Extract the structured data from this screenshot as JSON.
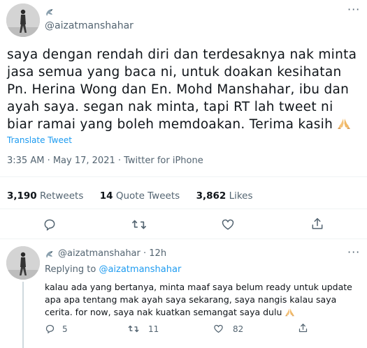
{
  "main_tweet": {
    "handle": "@aizatmanshahar",
    "text": "saya dengan rendah diri dan terdesaknya nak minta jasa semua yang baca ni, untuk doakan kesihatan Pn. Herina Wong dan En. Mohd Manshahar, ibu dan ayah saya. segan nak minta, tapi RT lah tweet ni biar ramai yang boleh memdoakan. Terima kasih",
    "translate_label": "Translate Tweet",
    "timestamp": "3:35 AM · May 17, 2021 · Twitter for iPhone",
    "stats": {
      "retweets_count": "3,190",
      "retweets_label": "Retweets",
      "quotes_count": "14",
      "quotes_label": "Quote Tweets",
      "likes_count": "3,862",
      "likes_label": "Likes"
    }
  },
  "reply": {
    "handle": "@aizatmanshahar",
    "time": "· 12h",
    "replying_to_label": "Replying to",
    "replying_to_handle": "@aizatmanshahar",
    "text": "kalau ada yang bertanya, minta maaf saya belum ready untuk update apa apa tentang mak ayah saya sekarang, saya nangis kalau saya cerita. for now, saya nak kuatkan semangat saya dulu",
    "reply_count": "5",
    "retweet_count": "11",
    "like_count": "82"
  },
  "icons": {
    "more": "more-dots-icon",
    "reply": "reply-bubble-icon",
    "retweet": "retweet-icon",
    "like": "heart-icon",
    "share": "share-icon",
    "verified_bird": "name-emoji-icon",
    "pray": "folded-hands-emoji"
  },
  "colors": {
    "text": "#0f1419",
    "muted": "#536471",
    "link": "#1d9bf0",
    "divider": "#eff3f4"
  }
}
